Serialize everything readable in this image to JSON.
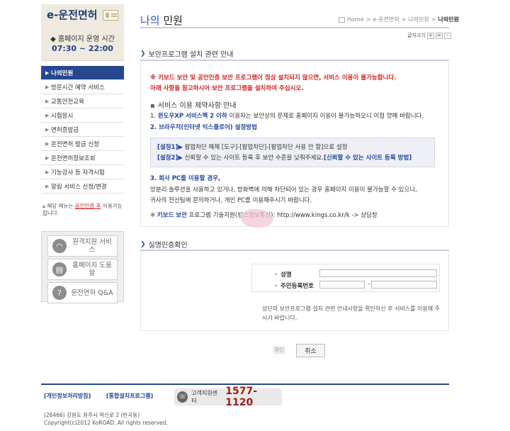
{
  "sidebar": {
    "logo": "e-운전면허",
    "hours_label": "◆ 홈페이지 운영 시간",
    "hours_time": "07:30 ~ 22:00",
    "menu": [
      {
        "label": "나의민원",
        "active": true
      },
      {
        "label": "방문시간 예약 서비스"
      },
      {
        "label": "교통안전교육"
      },
      {
        "label": "시험응시"
      },
      {
        "label": "면허증발급"
      },
      {
        "label": "운전면허 발급 신청"
      },
      {
        "label": "운전면허정보조회"
      },
      {
        "label": "기능강사 등 자격시험"
      },
      {
        "label": "알림 서비스 신청/변경"
      }
    ],
    "lock_note_pre": "해당 메뉴는",
    "lock_note_hl": "공인인증 후",
    "lock_note_post": "이용가능합니다.",
    "support": [
      {
        "icon": "remote-support-icon",
        "label": "원격지원 서비스"
      },
      {
        "icon": "homepage-help-icon",
        "label": "홈페이지 도움말"
      },
      {
        "icon": "faq-icon",
        "label": "운전면허 Q&A"
      }
    ]
  },
  "header": {
    "title_accent": "나의",
    "title_rest": " 민원",
    "breadcrumb": [
      "Home",
      "e-운전면허",
      "나의민원",
      "나의민원"
    ],
    "fontsize_label": "글자크기",
    "fontsize_buttons": [
      "+",
      "=",
      "-"
    ]
  },
  "notice": {
    "section_title": "보안프로그램 설치 관련 안내",
    "warn1": "※ 키보드 보안 및 공인인증 보안 프로그램이 정상 설치되지 않으면, 서비스 이용이 불가능합니다.",
    "warn2": "아래 사항을 참고하시어 보안 프로그램을 설치하여 주십시오.",
    "service_head": "서비스 이용 제약사항 안내",
    "item1_num": "1.",
    "item1_hl": "윈도우XP 서비스팩 2 이하",
    "item1_rest": "이용자는 보안상의 문제로 홈페이지 이용이 불가능하오니 이점 양해 바랍니다.",
    "item2": "2. 브라우저(인터넷 익스플로어) 설정방법",
    "step1_tag": "[설정1]▶",
    "step1_text": " 팝업차단 해제 [도구]-[팝업차단]-[팝업차단 사용 안 함]으로 설정",
    "step2_tag": "[설정2]▶",
    "step2_text": " 신뢰할 수 있는 사이트 등록 후 보안 수준을 낮춰주세요.",
    "step2_link": "[신뢰할 수 있는 사이트 등록 방법]",
    "item3": "3. 회사 PC를 이용할 경우,",
    "para1": "망분리 솔루션을 사용하고 있거나, 방화벽에 의해 차단되어 있는 경우 홈페이지 이용이 불가능할 수 있으니,",
    "para2": "귀사의 전산팀에 문의하거나, 개인 PC를 이용해주시기 바랍니다.",
    "kb_pre": "※",
    "kb_hl": "키보드 보안",
    "kb_rest": " 프로그램 기술지원(킹스정보통신): http://www.kings.co.kr/k -> 상담창"
  },
  "cert": {
    "section_title": "실명인증확인",
    "name_label": "성명",
    "jumin_label": "주민등록번호",
    "jumin_dash": "-",
    "note": "상단의 보안프로그램 설치 관련 안내사항을 확인하신 후 서비스를 이용해 주시기 바랍니다.",
    "confirm_label": "확인",
    "cancel_label": "취소"
  },
  "footer": {
    "link1": "[개인정보처리방침]",
    "link2": "[통합설치프로그램]",
    "call_label": "고객지원센터",
    "call_number": "1577-1120",
    "address": "(26466) 강원도 원주시 혁신로 2 (반곡동)",
    "copyright": "Copyright(c)2012 KoROAD. All rights reserved."
  }
}
